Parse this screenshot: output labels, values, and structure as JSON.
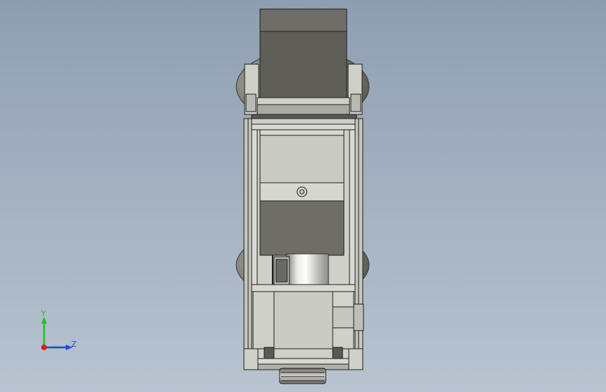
{
  "view": {
    "type": "3d-cad-viewport",
    "background_top": "#8e9eb2",
    "background_bottom": "#b9c3d0"
  },
  "triad": {
    "y_label": "Y",
    "z_label": "Z",
    "y_color": "#1fbf2a",
    "z_color": "#1d4fd8",
    "x_color": "#d81c1c"
  },
  "model": {
    "description_icon": "machine-assembly-front-view",
    "frame_color": "#cfd0c8",
    "dark_panel_color": "#6f6e66",
    "wheel_color": "#8c8a85"
  }
}
